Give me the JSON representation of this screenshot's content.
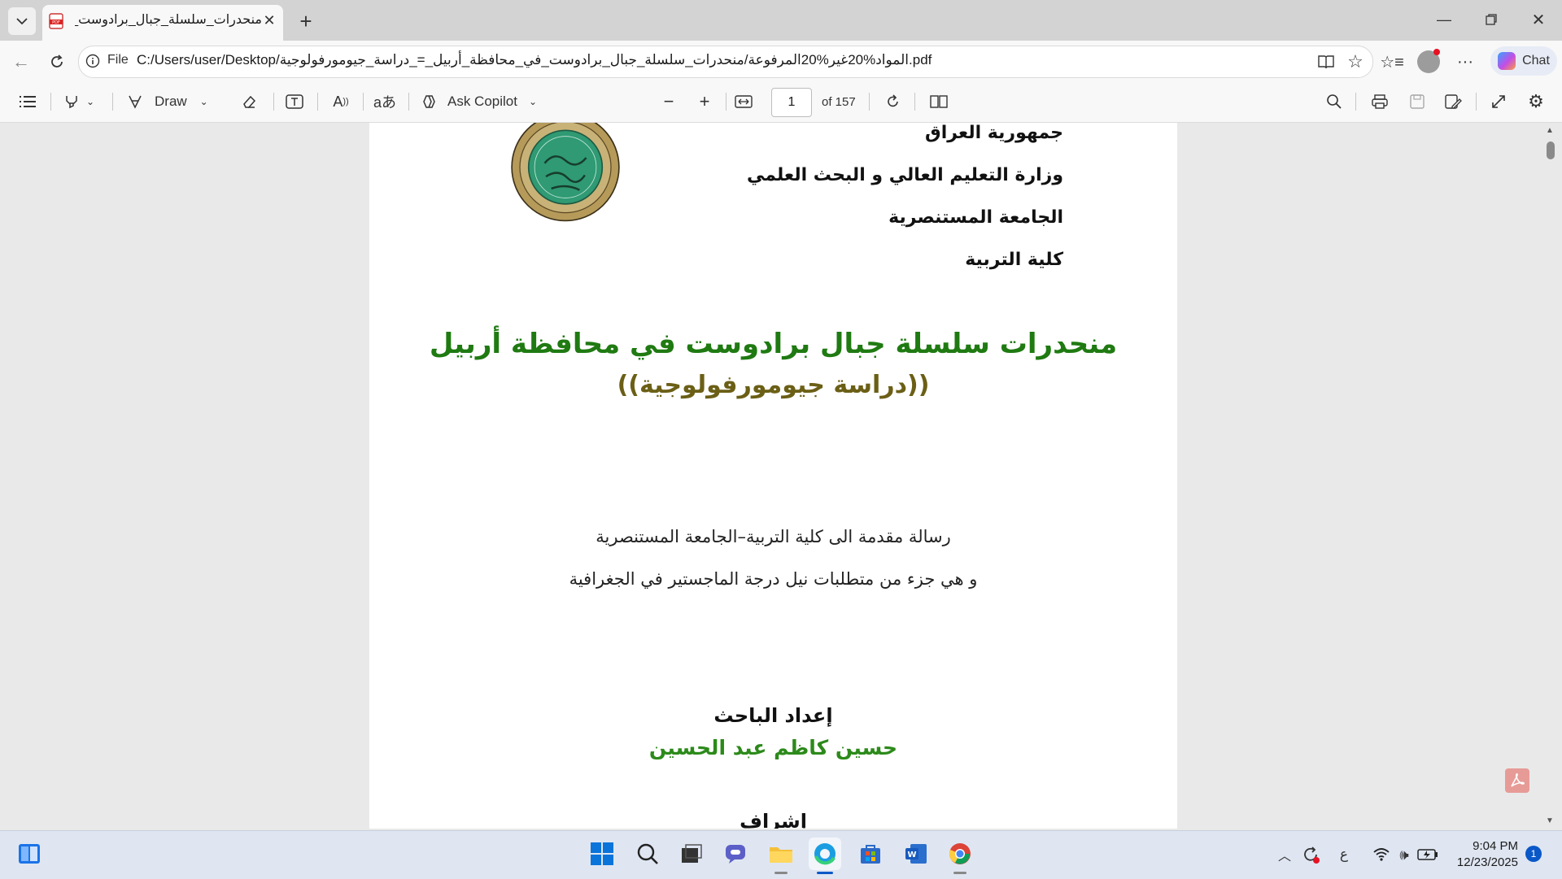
{
  "browser": {
    "tab_title": "منحدرات_سلسلة_جبال_برادوست_في...",
    "url_scheme_label": "File",
    "url": "C:/Users/user/Desktop/المواد%20غير%20المرفوعة/منحدرات_سلسلة_جبال_برادوست_في_محافظة_أربيل_=_دراسة_جيومورفولوجية.pdf",
    "chat_label": "Chat"
  },
  "pdf_toolbar": {
    "draw_label": "Draw",
    "copilot_label": "Ask Copilot",
    "page_current": "1",
    "page_total_label": "of 157"
  },
  "document": {
    "header_lines": [
      "جمهورية العراق",
      "وزارة التعليم العالي و البحث العلمي",
      "الجامعة المستنصرية",
      "كلية التربية"
    ],
    "title": "منحدرات سلسلة جبال برادوست في محافظة أربيل",
    "subtitle": "((دراسة جيومورفولوجية))",
    "submission_line1": "رسالة مقدمة الى كلية التربية–الجامعة المستنصرية",
    "submission_line2": "و هي جزء من متطلبات نيل درجة الماجستير في الجغرافية",
    "prepared_by_label": "إعداد الباحث",
    "researcher_name": "حسين كاظم عبد الحسين",
    "supervision_label": "إشراف"
  },
  "taskbar": {
    "lang_indicator": "ع",
    "time": "9:04 PM",
    "date": "12/23/2025",
    "notification_count": "1"
  },
  "colors": {
    "title_green": "#1f7a12",
    "subtitle_olive": "#6b5f16",
    "name_green": "#2c8a1a",
    "seal_green": "#2f9a73",
    "seal_gold": "#b59a5a"
  }
}
